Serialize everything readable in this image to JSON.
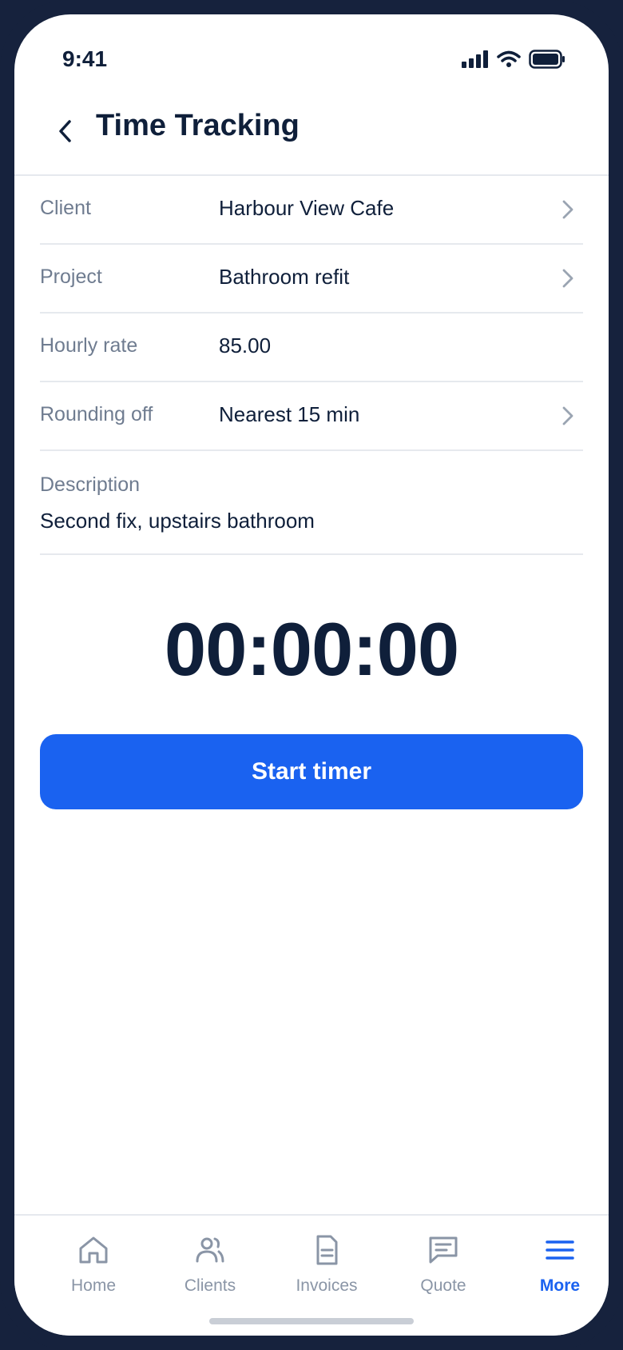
{
  "status_bar": {
    "time": "9:41"
  },
  "header": {
    "title": "Time Tracking"
  },
  "form": {
    "rows": [
      {
        "label": "Client",
        "value": "Harbour View Cafe",
        "has_chevron": true
      },
      {
        "label": "Project",
        "value": "Bathroom refit",
        "has_chevron": true
      },
      {
        "label": "Hourly rate",
        "value": "85.00",
        "has_chevron": false
      },
      {
        "label": "Rounding off",
        "value": "Nearest 15 min",
        "has_chevron": true
      }
    ],
    "description": {
      "label": "Description",
      "value": "Second fix, upstairs bathroom"
    }
  },
  "timer": {
    "display": "00:00:00",
    "button_label": "Start timer"
  },
  "tabbar": {
    "items": [
      {
        "label": "Home",
        "icon": "home-icon",
        "active": false
      },
      {
        "label": "Clients",
        "icon": "clients-icon",
        "active": false
      },
      {
        "label": "Invoices",
        "icon": "invoice-icon",
        "active": false
      },
      {
        "label": "Quote",
        "icon": "quote-icon",
        "active": false
      },
      {
        "label": "More",
        "icon": "menu-icon",
        "active": true
      }
    ]
  },
  "colors": {
    "accent": "#1a62f0",
    "text_primary": "#0f1f3a",
    "text_secondary": "#6f7c90",
    "frame": "#16223d"
  }
}
